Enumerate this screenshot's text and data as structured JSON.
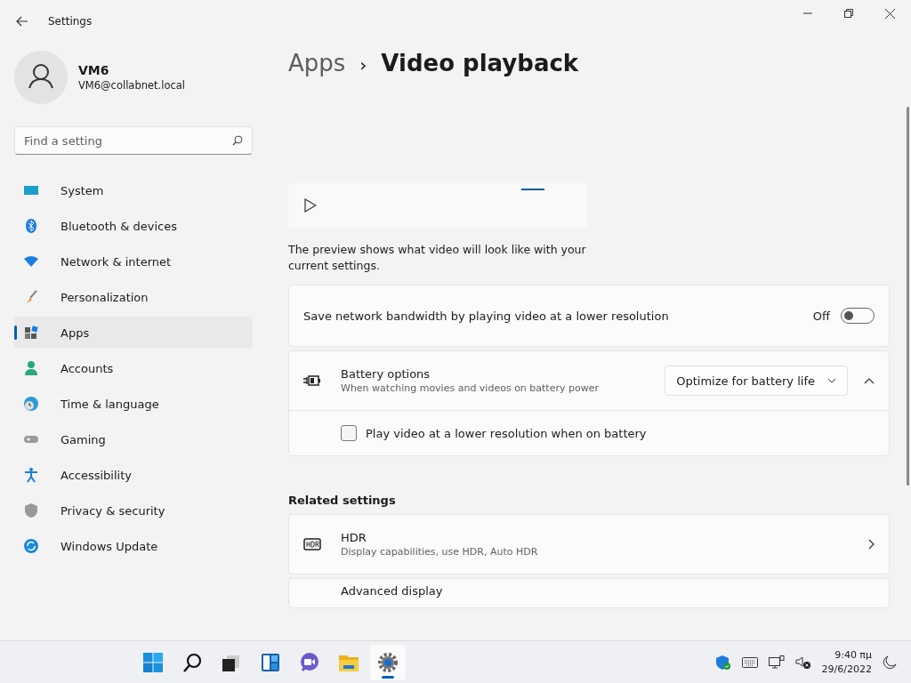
{
  "window": {
    "title": "Settings"
  },
  "profile": {
    "name": "VM6",
    "email": "VM6@collabnet.local"
  },
  "search": {
    "placeholder": "Find a setting"
  },
  "nav": [
    {
      "label": "System",
      "selected": false
    },
    {
      "label": "Bluetooth & devices",
      "selected": false
    },
    {
      "label": "Network & internet",
      "selected": false
    },
    {
      "label": "Personalization",
      "selected": false
    },
    {
      "label": "Apps",
      "selected": true
    },
    {
      "label": "Accounts",
      "selected": false
    },
    {
      "label": "Time & language",
      "selected": false
    },
    {
      "label": "Gaming",
      "selected": false
    },
    {
      "label": "Accessibility",
      "selected": false
    },
    {
      "label": "Privacy & security",
      "selected": false
    },
    {
      "label": "Windows Update",
      "selected": false
    }
  ],
  "breadcrumb": {
    "parent": "Apps",
    "separator": "›",
    "current": "Video playback"
  },
  "preview": {
    "description": "The preview shows what video will look like with your current settings."
  },
  "bandwidth": {
    "label": "Save network bandwidth by playing video at a lower resolution",
    "state": "Off",
    "on": false
  },
  "battery": {
    "title": "Battery options",
    "subtitle": "When watching movies and videos on battery power",
    "dropdown": "Optimize for battery life",
    "expanded": true,
    "checkbox": {
      "label": "Play video at a lower resolution when on battery",
      "checked": false
    }
  },
  "related": {
    "heading": "Related settings",
    "items": [
      {
        "title": "HDR",
        "subtitle": "Display capabilities, use HDR, Auto HDR"
      },
      {
        "title": "Advanced display"
      }
    ]
  },
  "taskbar": {
    "apps": [
      {
        "selected": false
      },
      {
        "selected": false
      },
      {
        "selected": false
      },
      {
        "selected": false
      },
      {
        "selected": false
      },
      {
        "selected": false
      },
      {
        "selected": true
      }
    ],
    "time": "9:40 πμ",
    "date": "29/6/2022"
  }
}
